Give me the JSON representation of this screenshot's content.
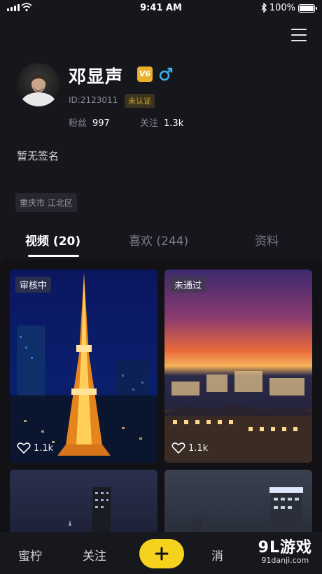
{
  "status_bar": {
    "time": "9:41 AM",
    "battery": "100%",
    "icons": [
      "signal-icon",
      "wifi-icon",
      "bluetooth-icon",
      "battery-icon"
    ]
  },
  "profile": {
    "name": "邓显声",
    "vip_badge": "V6",
    "id_text": "ID:2123011",
    "verify_status": "未认证",
    "fans_label": "粉丝",
    "fans_count": "997",
    "follows_label": "关注",
    "follows_count": "1.3k",
    "signature": "暂无签名",
    "location": "重庆市 江北区"
  },
  "tabs": [
    {
      "label": "视频 (20)",
      "active": true
    },
    {
      "label": "喜欢 (244)",
      "active": false
    },
    {
      "label": "资料",
      "active": false
    }
  ],
  "videos": [
    {
      "status": "审核中",
      "likes": "1.1k",
      "scene": "tokyo tower at night"
    },
    {
      "status": "未通过",
      "likes": "1.1k",
      "scene": "city skyline at sunset"
    },
    {
      "status": "",
      "likes": "",
      "scene": "night skyscraper"
    },
    {
      "status": "",
      "likes": "",
      "scene": "night skyscraper"
    }
  ],
  "bottom_nav": {
    "items": [
      "蜜柠",
      "关注",
      "消"
    ],
    "add_icon": "plus-icon"
  },
  "watermark": {
    "title": "9L游戏",
    "sub": "91danji.com"
  },
  "colors": {
    "background": "#16161d",
    "accent_yellow": "#f5d21d",
    "gender_blue": "#3fb2f0",
    "vip_gold": "#e9b12a"
  }
}
